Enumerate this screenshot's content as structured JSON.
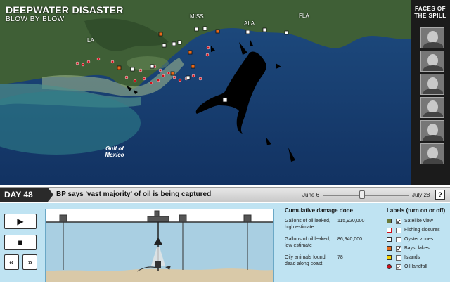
{
  "title": {
    "main": "DEEPWATER DISASTER",
    "sub": "BLOW BY BLOW"
  },
  "map_labels": {
    "la": "LA",
    "miss": "MISS",
    "ala": "ALA",
    "fla": "FLA",
    "gulf": "Gulf of Mexico"
  },
  "faces": {
    "title": "FACES OF THE SPILL"
  },
  "timeline": {
    "day": "DAY 48",
    "headline": "BP says 'vast majority' of oil is being captured",
    "start": "June 6",
    "end": "July 28",
    "help": "?",
    "position_fraction": 0.44
  },
  "controls": {
    "play": "▶",
    "stop": "■",
    "prev": "«",
    "next": "»"
  },
  "stats": {
    "heading": "Cumulative damage done",
    "rows": [
      {
        "label": "Gallons of oil leaked, high estimate",
        "value": "115,920,000"
      },
      {
        "label": "Gallons of oil leaked, low estimate",
        "value": "86,940,000"
      },
      {
        "label": "Oily animals found dead along coast",
        "value": "78"
      }
    ]
  },
  "legend": {
    "heading": "Labels (turn on or off)",
    "items": [
      {
        "label": "Satellite view",
        "checked": "✓",
        "swatch": "#6b7a3a"
      },
      {
        "label": "Fishing closures",
        "checked": "",
        "swatch": "#ffffff"
      },
      {
        "label": "Oyster zones",
        "checked": "",
        "swatch": "#ffffff"
      },
      {
        "label": "Bays, lakes",
        "checked": "✓",
        "swatch": "#e86a1a"
      },
      {
        "label": "Islands",
        "checked": "",
        "swatch": "#f5d000"
      },
      {
        "label": "Oil landfall",
        "checked": "✓",
        "swatch": "#d0101a"
      }
    ]
  },
  "colors": {
    "sea": "#1a3f72",
    "land": "#3b5d33",
    "oil": "#000000",
    "panel": "#bfe3f2"
  }
}
